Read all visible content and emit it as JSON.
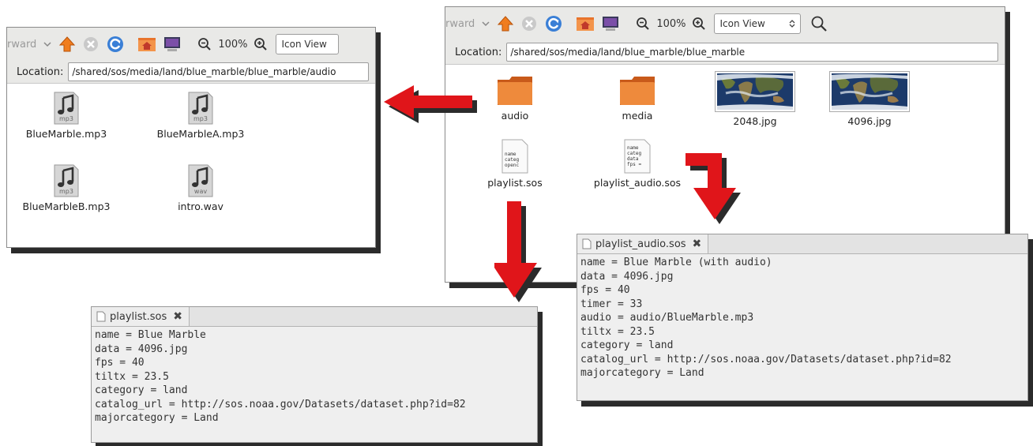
{
  "left_window": {
    "toolbar": {
      "forward_label": "rward",
      "zoom_text": "100%",
      "view_mode": "Icon View"
    },
    "location": {
      "label": "Location:",
      "path": "/shared/sos/media/land/blue_marble/blue_marble/audio"
    },
    "files": [
      {
        "name": "BlueMarble.mp3",
        "ext": "mp3"
      },
      {
        "name": "BlueMarbleA.mp3",
        "ext": "mp3"
      },
      {
        "name": "BlueMarbleB.mp3",
        "ext": "mp3"
      },
      {
        "name": "intro.wav",
        "ext": "wav"
      }
    ]
  },
  "right_window": {
    "toolbar": {
      "forward_label": "rward",
      "zoom_text": "100%",
      "view_mode": "Icon View"
    },
    "location": {
      "label": "Location:",
      "path": "/shared/sos/media/land/blue_marble/blue_marble"
    },
    "files": [
      {
        "name": "audio",
        "kind": "folder"
      },
      {
        "name": "media",
        "kind": "folder"
      },
      {
        "name": "2048.jpg",
        "kind": "image"
      },
      {
        "name": "4096.jpg",
        "kind": "image"
      },
      {
        "name": "playlist.sos",
        "kind": "text",
        "preview": [
          "name",
          "categ",
          "openc"
        ]
      },
      {
        "name": "playlist_audio.sos",
        "kind": "text",
        "preview": [
          "name",
          "categ",
          "data",
          "fps ="
        ]
      }
    ]
  },
  "editor_playlist": {
    "tab_label": "playlist.sos",
    "close_glyph": "✖",
    "lines": [
      "name = Blue Marble",
      "data = 4096.jpg",
      "fps = 40",
      "tiltx = 23.5",
      "category = land",
      "catalog_url = http://sos.noaa.gov/Datasets/dataset.php?id=82",
      "majorcategory = Land"
    ]
  },
  "editor_playlist_audio": {
    "tab_label": "playlist_audio.sos",
    "close_glyph": "✖",
    "lines": [
      "name = Blue Marble (with audio)",
      "data = 4096.jpg",
      "fps = 40",
      "timer = 33",
      "audio = audio/BlueMarble.mp3",
      "tiltx = 23.5",
      "category = land",
      "catalog_url = http://sos.noaa.gov/Datasets/dataset.php?id=82",
      "majorcategory = Land"
    ]
  },
  "colors": {
    "arrow": "#e0151a",
    "arrow_shadow": "#2b2b2b",
    "folder": "#e8742c"
  },
  "icons": [
    "chevron-down-icon",
    "home-icon",
    "stop-icon",
    "reload-icon",
    "home-folder-icon",
    "computer-icon",
    "zoom-out-icon",
    "zoom-in-icon",
    "search-icon",
    "music-file-icon",
    "folder-icon",
    "text-file-icon",
    "close-icon"
  ]
}
